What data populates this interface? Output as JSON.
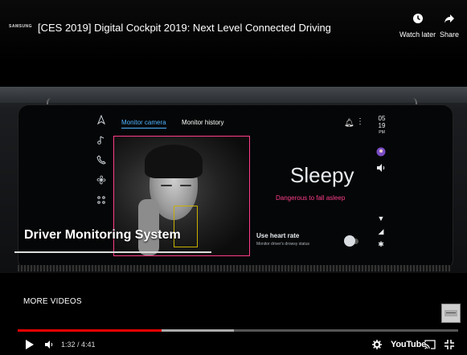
{
  "header": {
    "channel_logo": "SAMSUNG",
    "title": "[CES 2019] Digital Cockpit 2019: Next Level Connected Driving",
    "watch_later_label": "Watch later",
    "share_label": "Share"
  },
  "video": {
    "tabs": [
      "Monitor camera",
      "Monitor history"
    ],
    "status": "Sleepy",
    "warning": "Dangerous to fall asleep",
    "heart_rate_label": "Use heart rate",
    "heart_rate_sub": "Monitor driver's drowsy status",
    "clock_hour": "05",
    "clock_min": "19",
    "clock_ampm": "PM",
    "lower_third": "Driver Monitoring System"
  },
  "more_videos_label": "MORE VIDEOS",
  "player": {
    "current_time": "1:32",
    "duration": "4:41",
    "time_text": "1:32 / 4:41",
    "progress_fraction": 0.327,
    "buffer_fraction": 0.49,
    "youtube_label": "YouTube",
    "accent_color": "#ee0000"
  },
  "icons": [
    "watch-later-icon",
    "share-icon",
    "play-icon",
    "volume-icon",
    "settings-icon",
    "cast-icon",
    "fullscreen-icon"
  ]
}
